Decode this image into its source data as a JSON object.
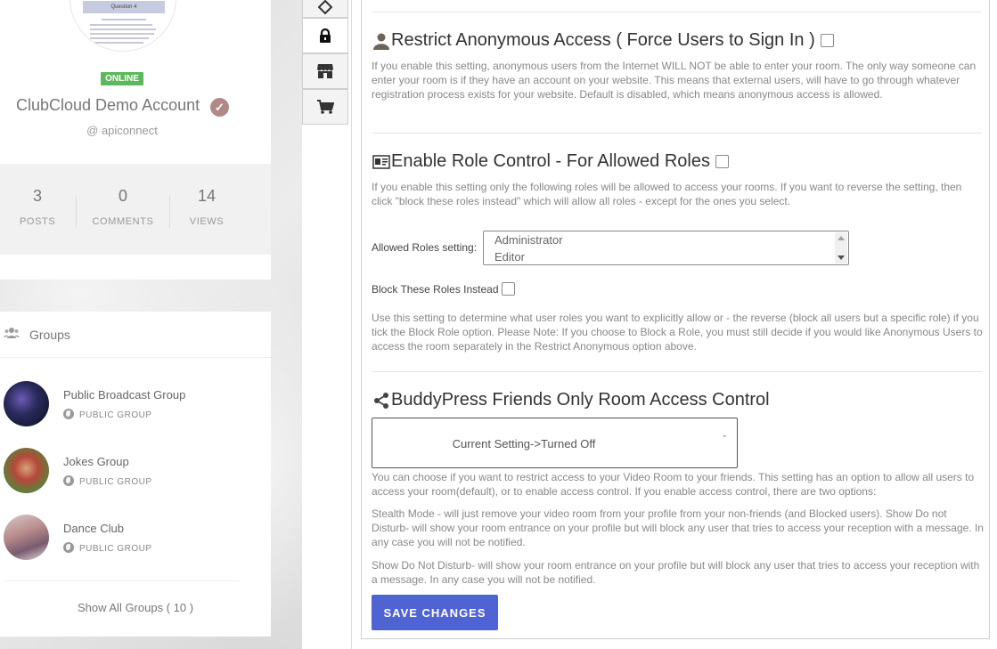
{
  "profile": {
    "avatar_doc_title": "Question 4",
    "status_badge": "ONLINE",
    "name": "ClubCloud Demo Account",
    "handle": "@ apiconnect",
    "stats": [
      {
        "value": "3",
        "label": "POSTS"
      },
      {
        "value": "0",
        "label": "COMMENTS"
      },
      {
        "value": "14",
        "label": "VIEWS"
      }
    ]
  },
  "groups": {
    "title": "Groups",
    "items": [
      {
        "name": "Public Broadcast Group",
        "type": "PUBLIC GROUP"
      },
      {
        "name": "Jokes Group",
        "type": "PUBLIC GROUP"
      },
      {
        "name": "Dance Club",
        "type": "PUBLIC GROUP"
      }
    ],
    "show_all": "Show All Groups ( 10 )"
  },
  "toolbar": {
    "icons": [
      "tag-icon",
      "lock-icon",
      "store-icon",
      "cart-icon"
    ]
  },
  "settings": {
    "restrict": {
      "title": "Restrict Anonymous Access ( Force Users to Sign In )",
      "desc": "If you enable this setting, anonymous users from the Internet WILL NOT be able to enter your room. The only way someone can enter your room is if they have an account on your website. This means that external users, will have to go through whatever registration process exists for your website. Default is disabled, which means anonymous access is allowed."
    },
    "role_control": {
      "title": "Enable Role Control - For Allowed Roles",
      "desc": "If you enable this setting only the following roles will be allowed to access your rooms. If you want to reverse the setting, then click \"block these roles instead\" which will allow all roles - except for the ones you select.",
      "roles_label": "Allowed Roles setting:",
      "roles_options": [
        "Administrator",
        "Editor"
      ],
      "block_label": "Block These Roles Instead",
      "note": "Use this setting to determine what user roles you want to explicitly allow or - the reverse (block all users but a specific role) if you tick the Block Role option. Please Note: If you choose to Block a Role, you must still decide if you would like Anonymous Users to access the room separately in the Restrict Anonymous option above."
    },
    "buddypress": {
      "title": "BuddyPress Friends Only Room Access Control",
      "select_value": "Current Setting->Turned Off",
      "desc1": "You can choose if you want to restrict access to your Video Room to your friends. This setting has an option to allow all users to access your room(default), or to enable access control. If you enable access control, there are two options:",
      "desc2": "Stealth Mode - will just remove your video room from your profile from your non-friends (and Blocked users). Show Do not Disturb- will show your room entrance on your profile but will block any user that tries to access your reception with a message. In any case you will not be notified.",
      "desc3": "Show Do Not Disturb- will show your room entrance on your profile but will block any user that tries to access your reception with a message. In any case you will not be notified."
    },
    "save_label": "SAVE CHANGES"
  },
  "colors": {
    "accent": "#4f63d2",
    "online": "#5cb85c",
    "verified": "#b08987"
  }
}
